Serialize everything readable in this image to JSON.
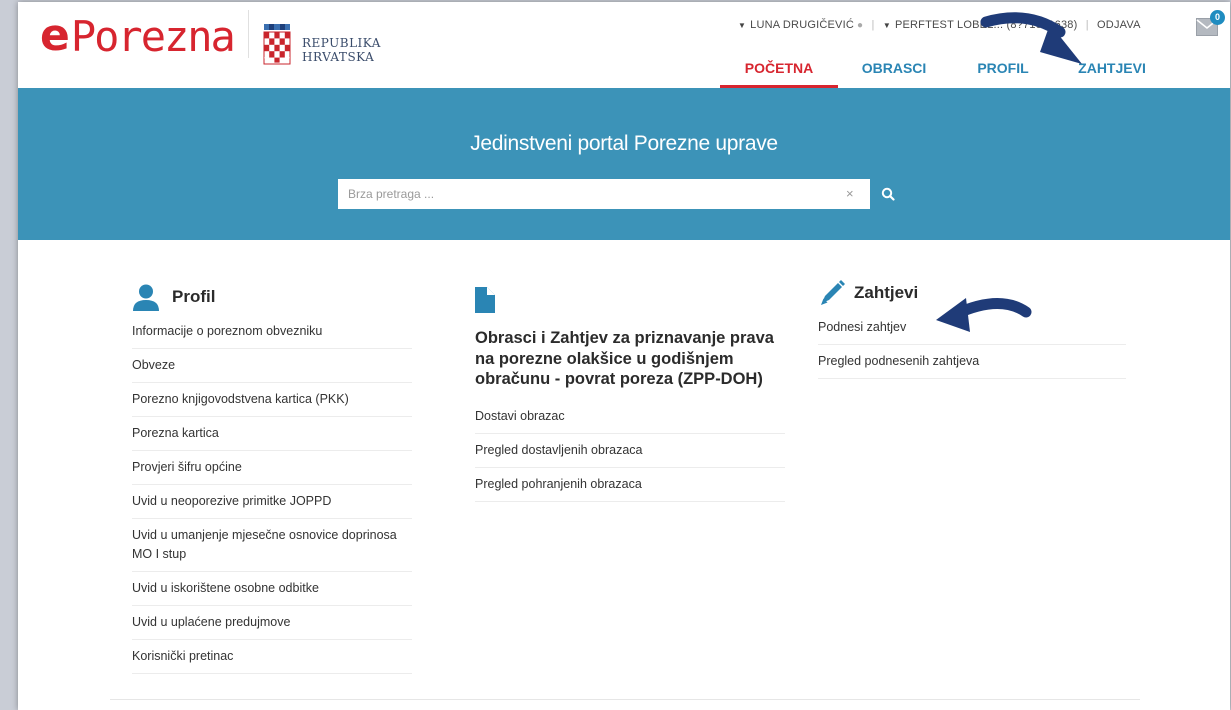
{
  "header": {
    "logo_e": "e",
    "logo_word": "Porezna",
    "republika_line1": "REPUBLIKA",
    "republika_line2": "HRVATSKA",
    "user_name": "LUNA DRUGIČEVIĆ",
    "company": "PERFTEST LOBEL... (8?71051638)",
    "logout": "ODJAVA",
    "mail_count": "0"
  },
  "nav": {
    "items": [
      {
        "label": "POČETNA",
        "active": true
      },
      {
        "label": "OBRASCI",
        "active": false
      },
      {
        "label": "PROFIL",
        "active": false
      },
      {
        "label": "ZAHTJEVI",
        "active": false
      }
    ]
  },
  "banner": {
    "title": "Jedinstveni portal Porezne uprave",
    "search_placeholder": "Brza pretraga ...",
    "clear_icon": "×"
  },
  "profil": {
    "title": "Profil",
    "links": [
      "Informacije o poreznom obvezniku",
      "Obveze",
      "Porezno knjigovodstvena kartica (PKK)",
      "Porezna kartica",
      "Provjeri šifru općine",
      "Uvid u neoporezive primitke JOPPD",
      "Uvid u umanjenje mjesečne osnovice doprinosa MO I stup",
      "Uvid u iskorištene osobne odbitke",
      "Uvid u uplaćene predujmove",
      "Korisnički pretinac"
    ]
  },
  "obrasci": {
    "title": "Obrasci i Zahtjev za priznavanje prava na porezne olakšice u godišnjem obračunu - povrat poreza (ZPP-DOH)",
    "links": [
      "Dostavi obrazac",
      "Pregled dostavljenih obrazaca",
      "Pregled pohranjenih obrazaca"
    ]
  },
  "zahtjevi": {
    "title": "Zahtjevi",
    "links": [
      "Podnesi zahtjev",
      "Pregled podnesenih zahtjeva"
    ]
  },
  "colors": {
    "brand_red": "#d7252f",
    "nav_blue": "#2a85b4",
    "banner_blue": "#3c93b8",
    "arrow_navy": "#1f3b78"
  },
  "icons": [
    "coat-of-arms-icon",
    "user-icon",
    "envelope-icon",
    "search-icon",
    "document-icon",
    "pencil-icon",
    "person-icon",
    "caret-down-icon"
  ]
}
